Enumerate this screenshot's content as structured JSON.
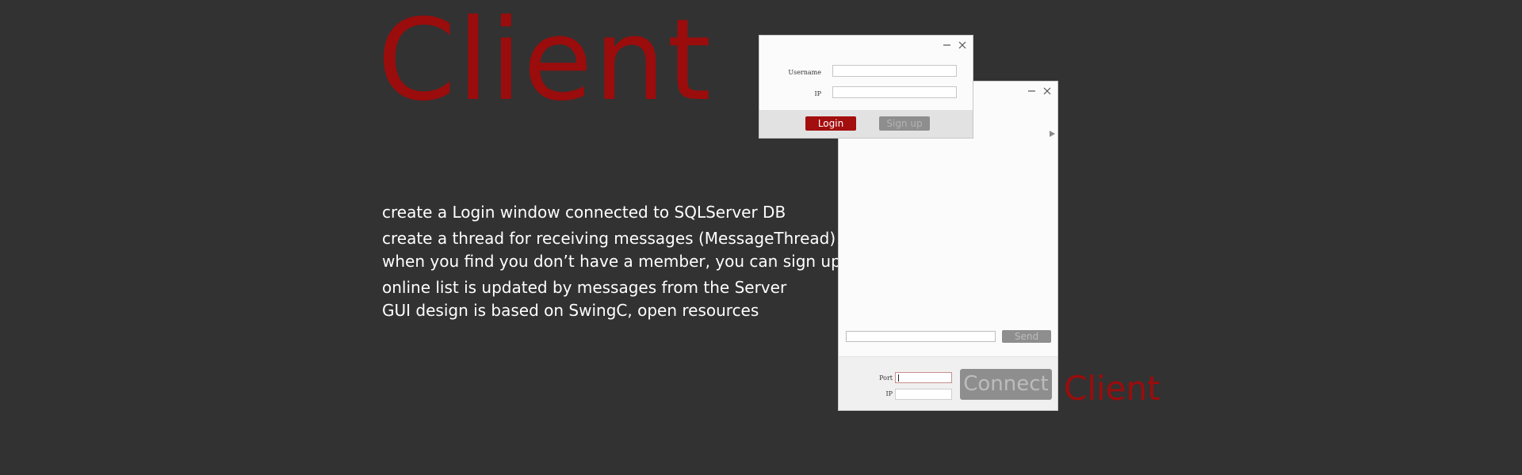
{
  "slide": {
    "title": "Client",
    "caption": "Client",
    "description": [
      "create a Login window connected to SQLServer DB",
      "create a thread for receiving messages (MessageThread)",
      "when you find you don’t have a member, you can sign up",
      "online list is updated by messages from the Server",
      "GUI design is based on SwingC, open resources"
    ]
  },
  "login_window": {
    "username_label": "Username",
    "username_value": "",
    "ip_label": "IP",
    "ip_value": "",
    "login_button": "Login",
    "signup_button": "Sign up"
  },
  "chat_window": {
    "message_value": "",
    "send_button": "Send",
    "port_label": "Port",
    "port_value": "",
    "ip_label": "IP",
    "ip_value": "",
    "connect_button": "Connect"
  },
  "colors": {
    "background": "#323232",
    "accent_red": "#9b0c0c",
    "login_button": "#a30e0e",
    "disabled_button": "#8e8e8e"
  },
  "icons": {
    "minimize": "minimize-icon",
    "close": "close-icon",
    "expand": "play-arrow-icon"
  }
}
